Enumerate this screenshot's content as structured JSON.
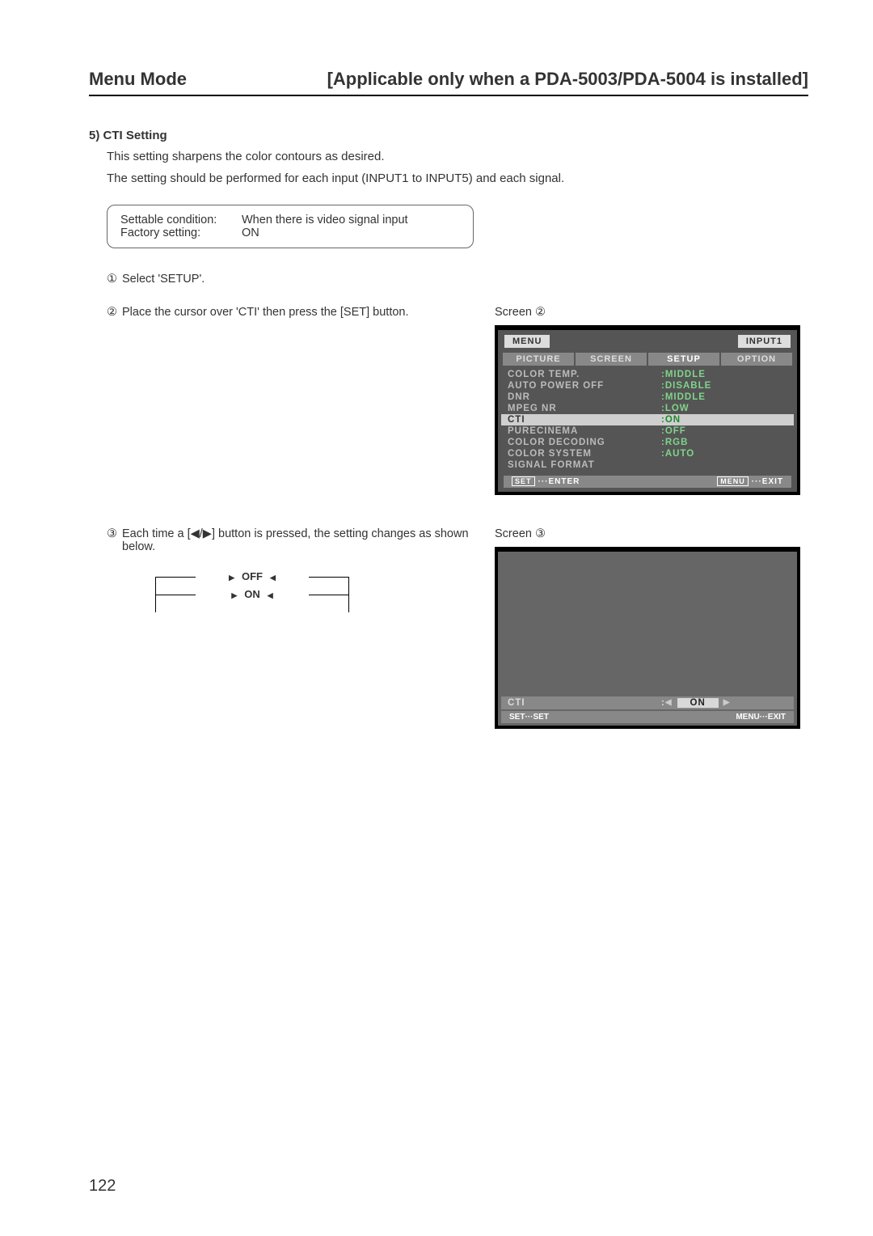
{
  "header": {
    "left": "Menu Mode",
    "right": "[Applicable only when a PDA-5003/PDA-5004 is installed]"
  },
  "section": {
    "number": "5)",
    "title": "CTI Setting",
    "desc1": "This setting sharpens the color contours as desired.",
    "desc2": "The setting should be performed for each input (INPUT1 to INPUT5) and each signal."
  },
  "condition": {
    "row1_label": "Settable condition:",
    "row1_value": "When there is video signal input",
    "row2_label": "Factory setting:",
    "row2_value": "ON"
  },
  "steps": {
    "s1_num": "①",
    "s1_text": "Select 'SETUP'.",
    "s2_num": "②",
    "s2_text": "Place the cursor over 'CTI' then press the [SET] button.",
    "s3_num": "③",
    "s3_text": "Each time a [◀/▶] button is pressed, the setting changes as shown below."
  },
  "screen2": {
    "label": "Screen ②",
    "menu_chip": "MENU",
    "input_chip": "INPUT1",
    "tabs": [
      "PICTURE",
      "SCREEN",
      "SETUP",
      "OPTION"
    ],
    "rows": [
      {
        "k": "COLOR TEMP.",
        "v": ":MIDDLE"
      },
      {
        "k": "AUTO POWER OFF",
        "v": ":DISABLE"
      },
      {
        "k": "DNR",
        "v": ":MIDDLE"
      },
      {
        "k": "MPEG NR",
        "v": ":LOW"
      },
      {
        "k": "CTI",
        "v": ":ON",
        "sel": true
      },
      {
        "k": "PURECINEMA",
        "v": ":OFF"
      },
      {
        "k": "COLOR DECODING",
        "v": ":RGB"
      },
      {
        "k": "COLOR SYSTEM",
        "v": ":AUTO"
      },
      {
        "k": "SIGNAL FORMAT",
        "v": ""
      }
    ],
    "foot_left_key": "SET",
    "foot_left_text": "···ENTER",
    "foot_right_key": "MENU",
    "foot_right_text": "···EXIT"
  },
  "screen3": {
    "label": "Screen ③",
    "row_label": "CTI",
    "row_colon": ":",
    "row_value": "ON",
    "foot_left_key": "SET",
    "foot_left_text": "···SET",
    "foot_right_key": "MENU",
    "foot_right_text": "···EXIT"
  },
  "toggle": {
    "off": "OFF",
    "on": "ON"
  },
  "page_number": "122"
}
